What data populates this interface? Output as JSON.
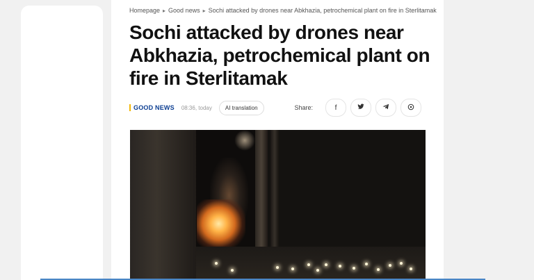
{
  "breadcrumb": {
    "items": [
      "Homepage",
      "Good news",
      "Sochi attacked by drones near Abkhazia, petrochemical plant on fire in Sterlitamak"
    ],
    "separator": "▸"
  },
  "article": {
    "title": "Sochi attacked by drones near Abkhazia, petrochemical plant on fire in Sterlitamak",
    "category": "GOOD NEWS",
    "time": "08:36, today",
    "ai_label": "AI translation"
  },
  "share": {
    "label": "Share:",
    "buttons": [
      {
        "icon": "facebook-icon",
        "glyph": "f"
      },
      {
        "icon": "twitter-icon",
        "glyph": "🐦"
      },
      {
        "icon": "telegram-icon",
        "glyph": "➤"
      },
      {
        "icon": "whatsapp-icon",
        "glyph": "◎"
      }
    ]
  },
  "colors": {
    "category_text": "#0b3d91",
    "category_accent": "#f2b705",
    "bottom_line": "#4a86c5"
  }
}
